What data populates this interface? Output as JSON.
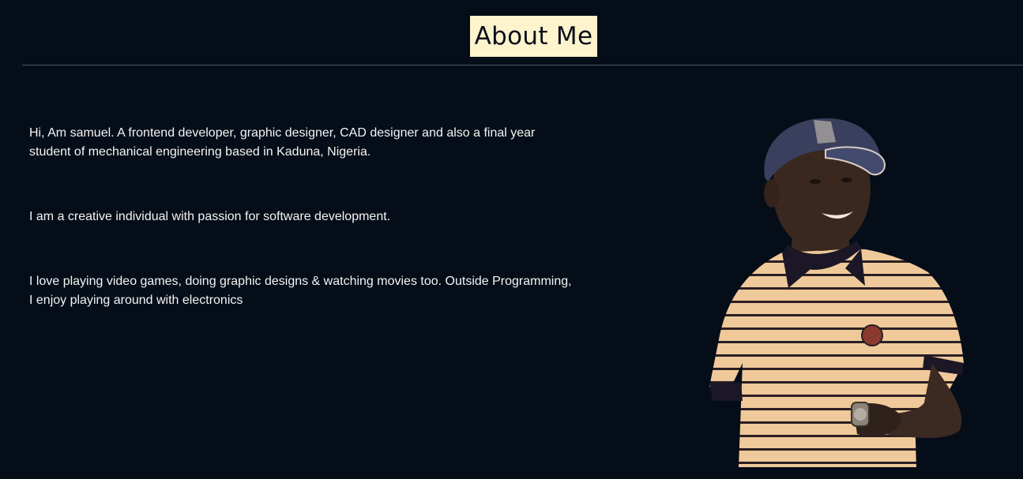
{
  "about": {
    "heading": "About Me",
    "paragraphs": [
      "Hi, Am samuel. A frontend developer, graphic designer, CAD designer and also a final year student of mechanical engineering based in Kaduna, Nigeria.",
      "I am a creative individual with passion for software development.",
      "I love playing video games, doing graphic designs & watching movies too. Outside Programming, I enjoy playing around with electronics"
    ]
  },
  "colors": {
    "background": "#050d18",
    "heading_bg": "#fdf3cc",
    "heading_text": "#0a0f1c",
    "divider": "#4b5563"
  },
  "photo": {
    "icon": "portrait-photo"
  }
}
